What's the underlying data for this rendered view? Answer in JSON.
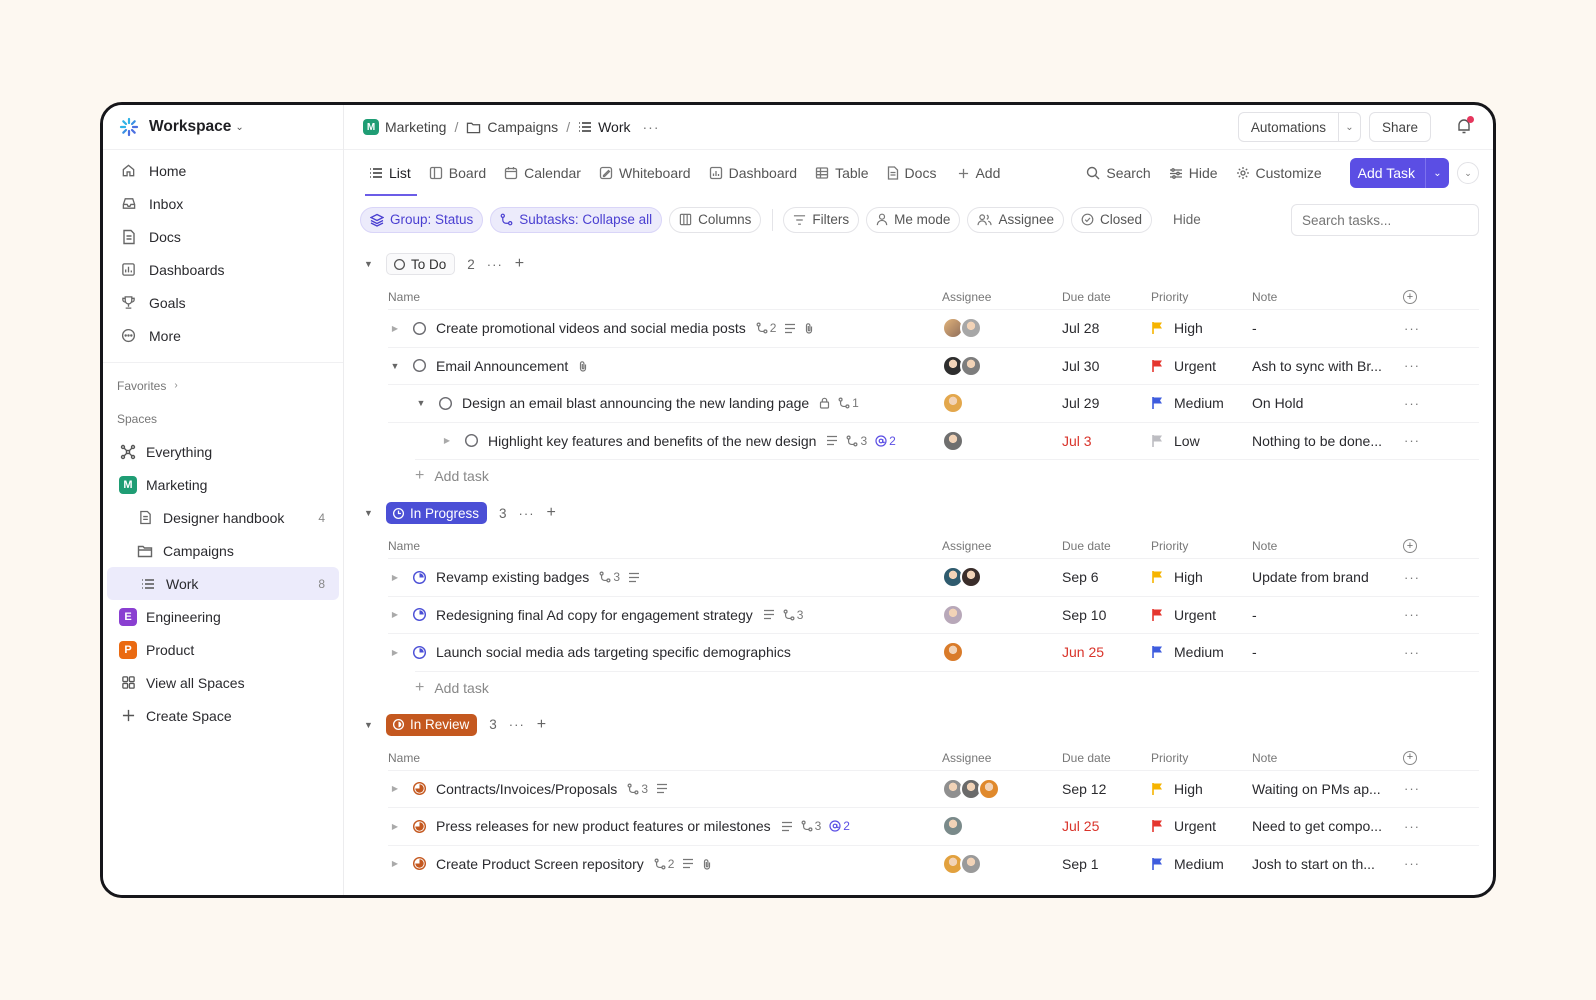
{
  "workspace": {
    "name": "Workspace"
  },
  "sidebar": {
    "nav": [
      {
        "label": "Home",
        "icon": "home-icon"
      },
      {
        "label": "Inbox",
        "icon": "inbox-icon"
      },
      {
        "label": "Docs",
        "icon": "docs-icon"
      },
      {
        "label": "Dashboards",
        "icon": "dashboards-icon"
      },
      {
        "label": "Goals",
        "icon": "trophy-icon"
      },
      {
        "label": "More",
        "icon": "more-icon"
      }
    ],
    "favorites_label": "Favorites",
    "spaces_label": "Spaces",
    "spaces": [
      {
        "label": "Everything",
        "icon": "everything-icon"
      },
      {
        "label": "Marketing",
        "letter": "M",
        "color": "#1f9d74"
      },
      {
        "label": "Designer handbook",
        "count": "4",
        "icon": "doc-icon"
      },
      {
        "label": "Campaigns",
        "icon": "folder-icon"
      },
      {
        "label": "Work",
        "count": "8",
        "icon": "list-icon"
      },
      {
        "label": "Engineering",
        "letter": "E",
        "color": "#8a3fd1"
      },
      {
        "label": "Product",
        "letter": "P",
        "color": "#ea6a12"
      },
      {
        "label": "View all Spaces",
        "icon": "grid-icon"
      },
      {
        "label": "Create Space",
        "icon": "plus-icon"
      }
    ]
  },
  "breadcrumb": {
    "space": "Marketing",
    "space_letter": "M",
    "folder": "Campaigns",
    "list": "Work"
  },
  "topbar": {
    "automations": "Automations",
    "share": "Share"
  },
  "views": {
    "tabs": [
      "List",
      "Board",
      "Calendar",
      "Whiteboard",
      "Dashboard",
      "Table",
      "Docs"
    ],
    "add": "Add",
    "search": "Search",
    "hide": "Hide",
    "customize": "Customize",
    "add_task": "Add Task"
  },
  "filters": {
    "group": "Group: Status",
    "subtasks": "Subtasks: Collapse all",
    "columns": "Columns",
    "filters": "Filters",
    "me_mode": "Me mode",
    "assignee": "Assignee",
    "closed": "Closed",
    "hide": "Hide",
    "search_placeholder": "Search tasks..."
  },
  "columns": {
    "name": "Name",
    "assignee": "Assignee",
    "due": "Due date",
    "priority": "Priority",
    "note": "Note"
  },
  "add_task_label": "Add task",
  "colors": {
    "accent": "#5b4ee4",
    "urgent": "#e5362e",
    "high": "#f6b400",
    "medium": "#3e5cde",
    "low": "#bdbdc2",
    "in_progress": "#4b4fd6",
    "in_review": "#c4581f"
  },
  "groups": [
    {
      "status": "To Do",
      "count": "2",
      "tasks": [
        {
          "name": "Create promotional videos and social media posts",
          "subtasks": "2",
          "has_desc": true,
          "has_attach": true,
          "due": "Jul 28",
          "priority": "High",
          "note": "-"
        },
        {
          "name": "Email Announcement",
          "has_attach": true,
          "due": "Jul 30",
          "priority": "Urgent",
          "note": "Ash to sync with Br..."
        },
        {
          "name": "Design an email blast announcing the new landing page",
          "locked": true,
          "subtasks": "1",
          "due": "Jul 29",
          "priority": "Medium",
          "note": "On Hold"
        },
        {
          "name": "Highlight key features and benefits of the new design",
          "has_desc": true,
          "subtasks": "3",
          "mentions": "2",
          "due": "Jul 3",
          "due_overdue": true,
          "priority": "Low",
          "note": "Nothing to be done..."
        }
      ]
    },
    {
      "status": "In Progress",
      "count": "3",
      "tasks": [
        {
          "name": "Revamp existing badges",
          "subtasks": "3",
          "has_desc": true,
          "due": "Sep 6",
          "priority": "High",
          "note": "Update from brand"
        },
        {
          "name": "Redesigning final Ad copy for engagement strategy",
          "has_desc": true,
          "subtasks": "3",
          "due": "Sep 10",
          "priority": "Urgent",
          "note": "-"
        },
        {
          "name": "Launch social media ads targeting specific demographics",
          "due": "Jun 25",
          "due_overdue": true,
          "priority": "Medium",
          "note": "-"
        }
      ]
    },
    {
      "status": "In Review",
      "count": "3",
      "tasks": [
        {
          "name": "Contracts/Invoices/Proposals",
          "subtasks": "3",
          "has_desc": true,
          "due": "Sep 12",
          "priority": "High",
          "note": "Waiting on PMs ap..."
        },
        {
          "name": "Press releases for new product features or milestones",
          "has_desc": true,
          "subtasks": "3",
          "mentions": "2",
          "due": "Jul 25",
          "due_overdue": true,
          "priority": "Urgent",
          "note": "Need to get compo..."
        },
        {
          "name": "Create Product Screen repository",
          "subtasks": "2",
          "has_desc": true,
          "has_attach": true,
          "due": "Sep 1",
          "priority": "Medium",
          "note": "Josh to start on th..."
        }
      ]
    }
  ]
}
